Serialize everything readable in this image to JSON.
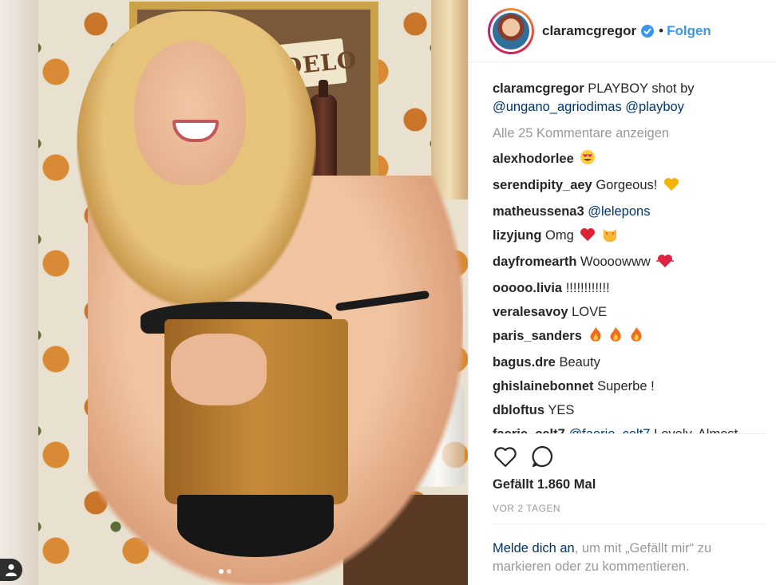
{
  "photo": {
    "sign_text": "MODELO",
    "carousel_dots": 2,
    "carousel_active": 1
  },
  "header": {
    "username": "claramcgregor",
    "bullet": "•",
    "follow_label": "Folgen"
  },
  "caption": {
    "user": "claramcgregor",
    "text": "PLAYBOY shot by",
    "mention1": "@ungano_agriodimas",
    "mention2": "@playboy"
  },
  "view_all_label": "Alle 25 Kommentare anzeigen",
  "comments": [
    {
      "user": "alexhodorlee",
      "text": "",
      "emoji": [
        "heart-eyes"
      ]
    },
    {
      "user": "serendipity_aey",
      "text": "Gorgeous!",
      "emoji": [
        "yellow-heart"
      ]
    },
    {
      "user": "matheussena3",
      "text": "",
      "mention": "@lelepons"
    },
    {
      "user": "lizyjung",
      "text": "Omg",
      "emoji": [
        "red-heart",
        "heart-eyes-cat"
      ]
    },
    {
      "user": "dayfromearth",
      "text": "Woooowww",
      "emoji": [
        "beating-heart"
      ]
    },
    {
      "user": "ooooo.livia",
      "text": "!!!!!!!!!!!!"
    },
    {
      "user": "veralesavoy",
      "text": "LOVE"
    },
    {
      "user": "paris_sanders",
      "text": "",
      "emoji": [
        "fire",
        "fire",
        "fire"
      ]
    },
    {
      "user": "bagus.dre",
      "text": "Beauty"
    },
    {
      "user": "ghislainebonnet",
      "text": "Superbe !"
    },
    {
      "user": "dbloftus",
      "text": "YES"
    },
    {
      "user": "faerie_celt7",
      "text": "Lovely. Almost",
      "mention": "@faerie_celt7"
    }
  ],
  "likes_label": "Gefällt 1.860 Mal",
  "time_label": "VOR 2 TAGEN",
  "login": {
    "link": "Melde dich an",
    "rest": ", um mit „Gefällt mir“ zu markieren oder zu kommentieren."
  },
  "colors": {
    "link_blue": "#3897f0",
    "mention_blue": "#003569",
    "muted": "#999999",
    "text": "#262626"
  }
}
